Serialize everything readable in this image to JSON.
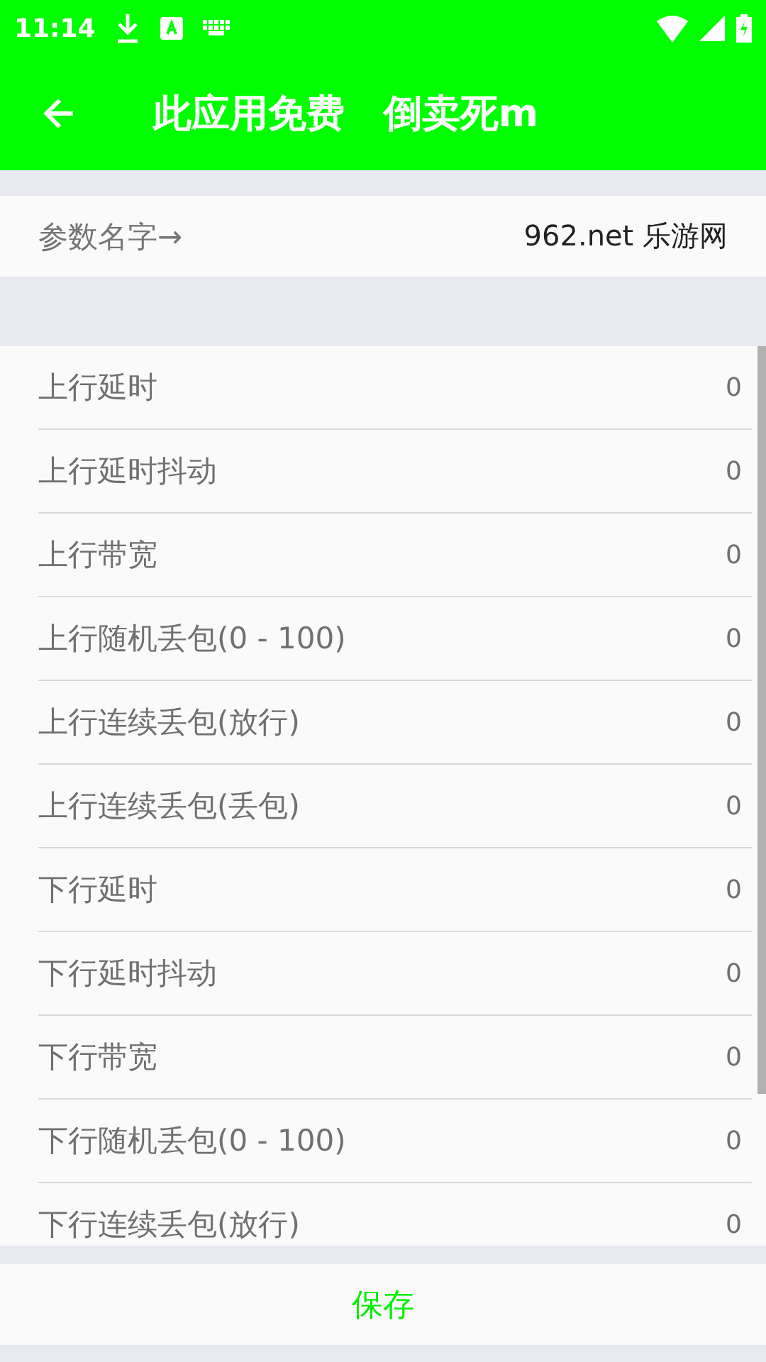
{
  "status_bar": {
    "time": "11:14"
  },
  "toolbar": {
    "title": "此应用免费 倒卖死m"
  },
  "header_row": {
    "label": "参数名字→",
    "value": "962.net 乐游网"
  },
  "params": [
    {
      "label": "上行延时",
      "value": "0"
    },
    {
      "label": "上行延时抖动",
      "value": "0"
    },
    {
      "label": "上行带宽",
      "value": "0"
    },
    {
      "label": "上行随机丢包(0 - 100)",
      "value": "0"
    },
    {
      "label": "上行连续丢包(放行)",
      "value": "0"
    },
    {
      "label": "上行连续丢包(丢包)",
      "value": "0"
    },
    {
      "label": "下行延时",
      "value": "0"
    },
    {
      "label": "下行延时抖动",
      "value": "0"
    },
    {
      "label": "下行带宽",
      "value": "0"
    },
    {
      "label": "下行随机丢包(0 - 100)",
      "value": "0"
    },
    {
      "label": "下行连续丢包(放行)",
      "value": "0"
    }
  ],
  "save_button": {
    "label": "保存"
  }
}
